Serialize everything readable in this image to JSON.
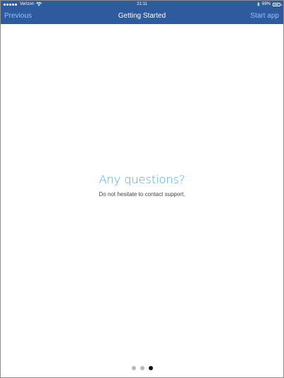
{
  "status_bar": {
    "carrier": "Verizon",
    "time": "21:11",
    "battery_percent": "69%",
    "icons": [
      "signal-dots-icon",
      "wifi-icon",
      "bluetooth-icon",
      "battery-icon"
    ]
  },
  "nav": {
    "left_label": "Previous",
    "title": "Getting Started",
    "right_label": "Start app"
  },
  "page": {
    "headline": "Any questions?",
    "subtext": "Do not hesitate to contact support."
  },
  "pagination": {
    "total": 3,
    "current": 3
  },
  "colors": {
    "nav_background": "#2f5a9e",
    "nav_link": "#8fc3ff",
    "headline": "#4da6e8",
    "dot_inactive": "#b9b9b9",
    "dot_active": "#111111"
  }
}
